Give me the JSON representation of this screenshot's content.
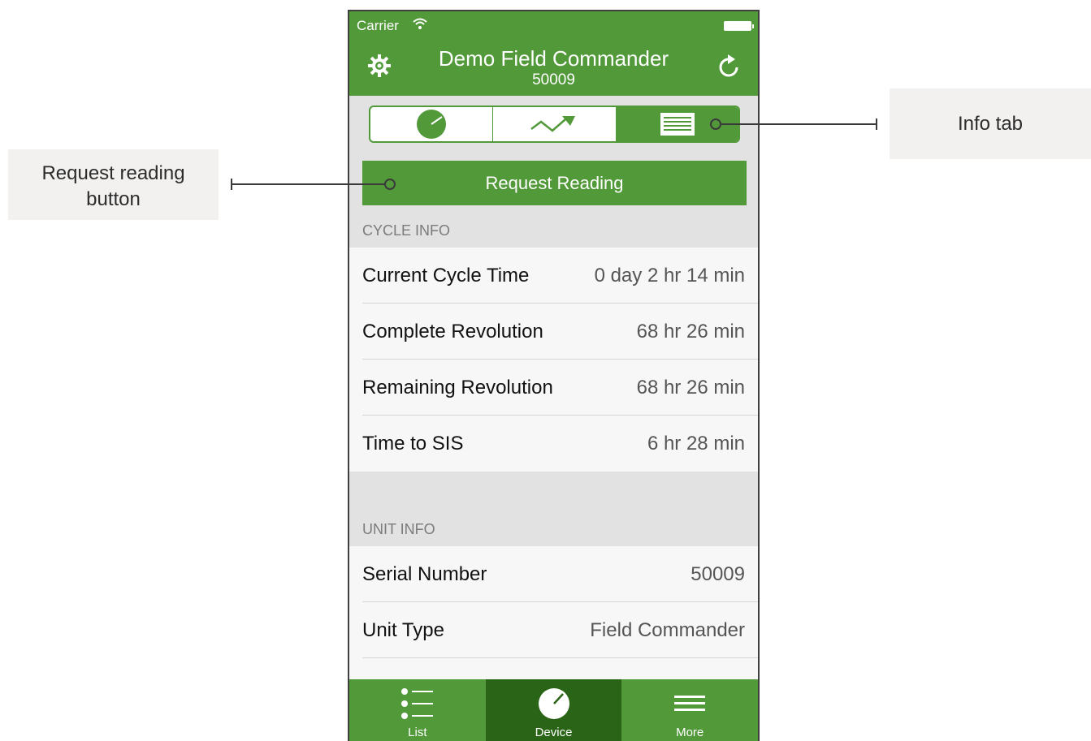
{
  "statusbar": {
    "carrier": "Carrier"
  },
  "navbar": {
    "title": "Demo Field Commander",
    "subtitle": "50009"
  },
  "segments": [
    {
      "icon": "gauge-icon"
    },
    {
      "icon": "trend-chart-icon"
    },
    {
      "icon": "info-list-icon",
      "selected": true
    }
  ],
  "actions": {
    "request_reading": "Request Reading"
  },
  "cycle_info": {
    "header": "CYCLE INFO",
    "rows": [
      {
        "label": "Current Cycle Time",
        "value": "0 day 2 hr 14 min"
      },
      {
        "label": "Complete Revolution",
        "value": "68 hr 26 min"
      },
      {
        "label": "Remaining Revolution",
        "value": "68 hr 26 min"
      },
      {
        "label": "Time to SIS",
        "value": "6 hr 28 min"
      }
    ]
  },
  "unit_info": {
    "header": "UNIT INFO",
    "rows": [
      {
        "label": "Serial Number",
        "value": "50009"
      },
      {
        "label": "Unit Type",
        "value": "Field Commander"
      }
    ]
  },
  "tabbar": {
    "tabs": [
      {
        "label": "List",
        "icon": "list-icon"
      },
      {
        "label": "Device",
        "icon": "gauge-icon",
        "active": true
      },
      {
        "label": "More",
        "icon": "menu-icon"
      }
    ]
  },
  "callouts": {
    "info_tab": "Info tab",
    "request_line1": "Request reading",
    "request_line2": "button"
  },
  "colors": {
    "brand_green": "#52993a",
    "active_tab": "#2a6417",
    "section_bg": "#e2e2e2"
  }
}
